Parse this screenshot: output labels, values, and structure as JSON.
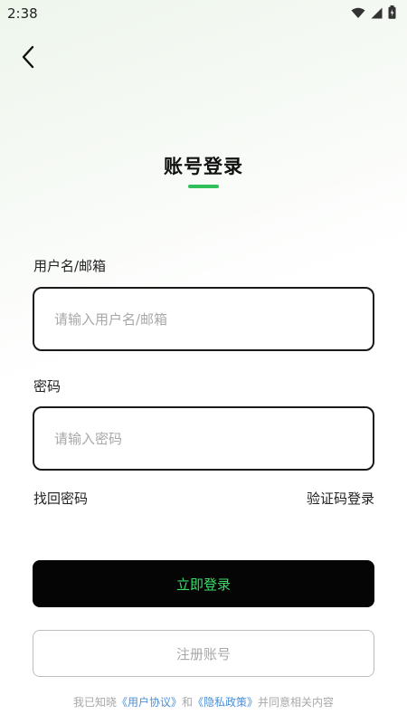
{
  "status_bar": {
    "time": "2:38",
    "icons": [
      "wifi-icon",
      "signal-icon",
      "battery-icon"
    ]
  },
  "header": {
    "back_icon": "chevron-left-icon",
    "title": "账号登录"
  },
  "form": {
    "username_label": "用户名/邮箱",
    "username_placeholder": "请输入用户名/邮箱",
    "username_value": "",
    "password_label": "密码",
    "password_placeholder": "请输入密码",
    "password_value": ""
  },
  "links": {
    "forgot_password": "找回密码",
    "code_login": "验证码登录"
  },
  "buttons": {
    "login": "立即登录",
    "register": "注册账号"
  },
  "agreement": {
    "prefix": "我已知晓",
    "user_agreement": "《用户协议》",
    "conjunction": "和",
    "privacy_policy": "《隐私政策》",
    "suffix": "并同意相关内容"
  },
  "colors": {
    "accent": "#2fbf5b",
    "login_text": "#3ddc6a",
    "link": "#4a8fd6",
    "placeholder": "#a8a8a8"
  }
}
